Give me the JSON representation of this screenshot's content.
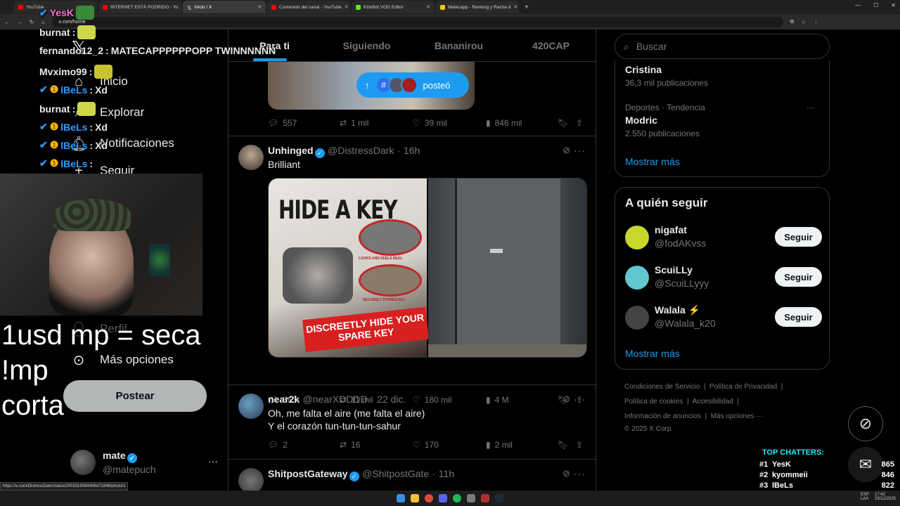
{
  "browser": {
    "tabs": [
      {
        "title": "YouTube",
        "color": "#ff0000"
      },
      {
        "title": "INTERNET ESTÁ PODRIDO - Yo",
        "color": "#ff0000"
      },
      {
        "title": "Inicio / X",
        "color": "#ffffff",
        "active": true
      },
      {
        "title": "Contenido del canal - YouTube",
        "color": "#ff0000"
      },
      {
        "title": "KickBot VOD Editor",
        "color": "#53fc18"
      },
      {
        "title": "Matecapp - Ranking y Racha d",
        "color": "#f5c518"
      }
    ],
    "url": "x.com/home",
    "status_url": "https://x.com/DistressDark/status/2003319094406471948/photo/1"
  },
  "nav": {
    "items": [
      {
        "label": "Inicio",
        "icon": "home-icon"
      },
      {
        "label": "Explorar",
        "icon": "search-icon"
      },
      {
        "label": "Notificaciones",
        "icon": "bell-icon"
      },
      {
        "label": "Seguir",
        "icon": "person-plus-icon"
      },
      {
        "label": "Perfil",
        "icon": "person-icon"
      },
      {
        "label": "Más opciones",
        "icon": "more-circle-icon"
      }
    ],
    "post_button": "Postear",
    "account": {
      "name": "mate",
      "handle": "@matepuch"
    }
  },
  "feed": {
    "tabs": [
      "Para ti",
      "Siguiendo",
      "Bananirou",
      "420CAP"
    ],
    "posted_pill": "posteó",
    "tweets": [
      {
        "replies": "557",
        "retweets": "1 mil",
        "likes": "39 mil",
        "views": "846 mil"
      },
      {
        "name": "Unhinged",
        "handle": "@DistressDark",
        "time": "16h",
        "text": "Brilliant",
        "image_text_1": "HIDE A KEY",
        "image_text_2": "DISCREETLY HIDE YOUR SPARE KEY",
        "image_text_3": "LOOKS AND FEELS REAL",
        "image_text_4": "SECURELY STORES KEY",
        "replies": "363",
        "retweets": "11 mil",
        "likes": "180 mil",
        "views": "4 M"
      },
      {
        "name": "near2k",
        "handle": "@nearXDDDD",
        "time": "22 dic.",
        "text_line1": "Oh, me falta el aire (me falta el aire)",
        "text_line2": "Y el corazón tun-tun-tun-sahur",
        "replies": "2",
        "retweets": "16",
        "likes": "170",
        "views": "2 mil"
      },
      {
        "name": "ShitpostGateway",
        "handle": "@ShitpostGate",
        "time": "11h"
      }
    ]
  },
  "right": {
    "search_placeholder": "Buscar",
    "trends": [
      {
        "context": "",
        "name": "Cristina",
        "count": "36,3 mil publicaciones"
      },
      {
        "context": "Deportes · Tendencia",
        "name": "Modric",
        "count": "2.550 publicaciones"
      }
    ],
    "show_more": "Mostrar más",
    "who_to_follow_title": "A quién seguir",
    "follow": [
      {
        "name": "nigafat",
        "handle": "@fodAKvss",
        "color": "#c8d82a"
      },
      {
        "name": "ScuiLLy",
        "handle": "@ScuiLLyyy",
        "color": "#5fc8d0"
      },
      {
        "name": "Walala ⚡",
        "handle": "@Walala_k20",
        "color": "#444444"
      }
    ],
    "follow_button": "Seguir",
    "footer": {
      "l1a": "Condiciones de Servicio",
      "l1b": "Política de Privacidad",
      "l2a": "Política de cookies",
      "l2b": "Accesibilidad",
      "l3a": "Información de anuncios",
      "l3b": "Más opciones ···",
      "copy": "© 2025 X Corp."
    }
  },
  "stream": {
    "chat": [
      {
        "user": "YesK",
        "msg": "",
        "color": "#ff6fd0"
      },
      {
        "user": "burnat",
        "msg": "",
        "color": "#e7e9ea"
      },
      {
        "user": "fernando12_2",
        "msg": "MATECAPPPPPPOPP TWINNNNNN",
        "color": "#e7e9ea"
      },
      {
        "user": "Mvximo99",
        "msg": "",
        "color": "#e7e9ea"
      },
      {
        "user": "lBeLs",
        "msg": "Xd",
        "color": "#2e9bff"
      },
      {
        "user": "burnat",
        "msg": "",
        "color": "#e7e9ea"
      },
      {
        "user": "lBeLs",
        "msg": "Xd",
        "color": "#2e9bff"
      },
      {
        "user": "lBeLs",
        "msg": "Xd",
        "color": "#2e9bff"
      },
      {
        "user": "lBeLs",
        "msg": "",
        "color": "#2e9bff"
      }
    ],
    "overlay_line1": "1usd mp = seca",
    "overlay_line2": "!mp",
    "overlay_line3": "corta",
    "top_chatters_title": "TOP CHATTERS:",
    "top_chatters": [
      {
        "rank": "#1",
        "name": "YesK",
        "score": "865"
      },
      {
        "rank": "#2",
        "name": "kyommeii",
        "score": "846"
      },
      {
        "rank": "#3",
        "name": "lBeLs",
        "score": "822"
      }
    ]
  },
  "taskbar": {
    "lang1": "ESP",
    "lang2": "LAA",
    "time": "17:42",
    "date": "23/12/2025"
  }
}
